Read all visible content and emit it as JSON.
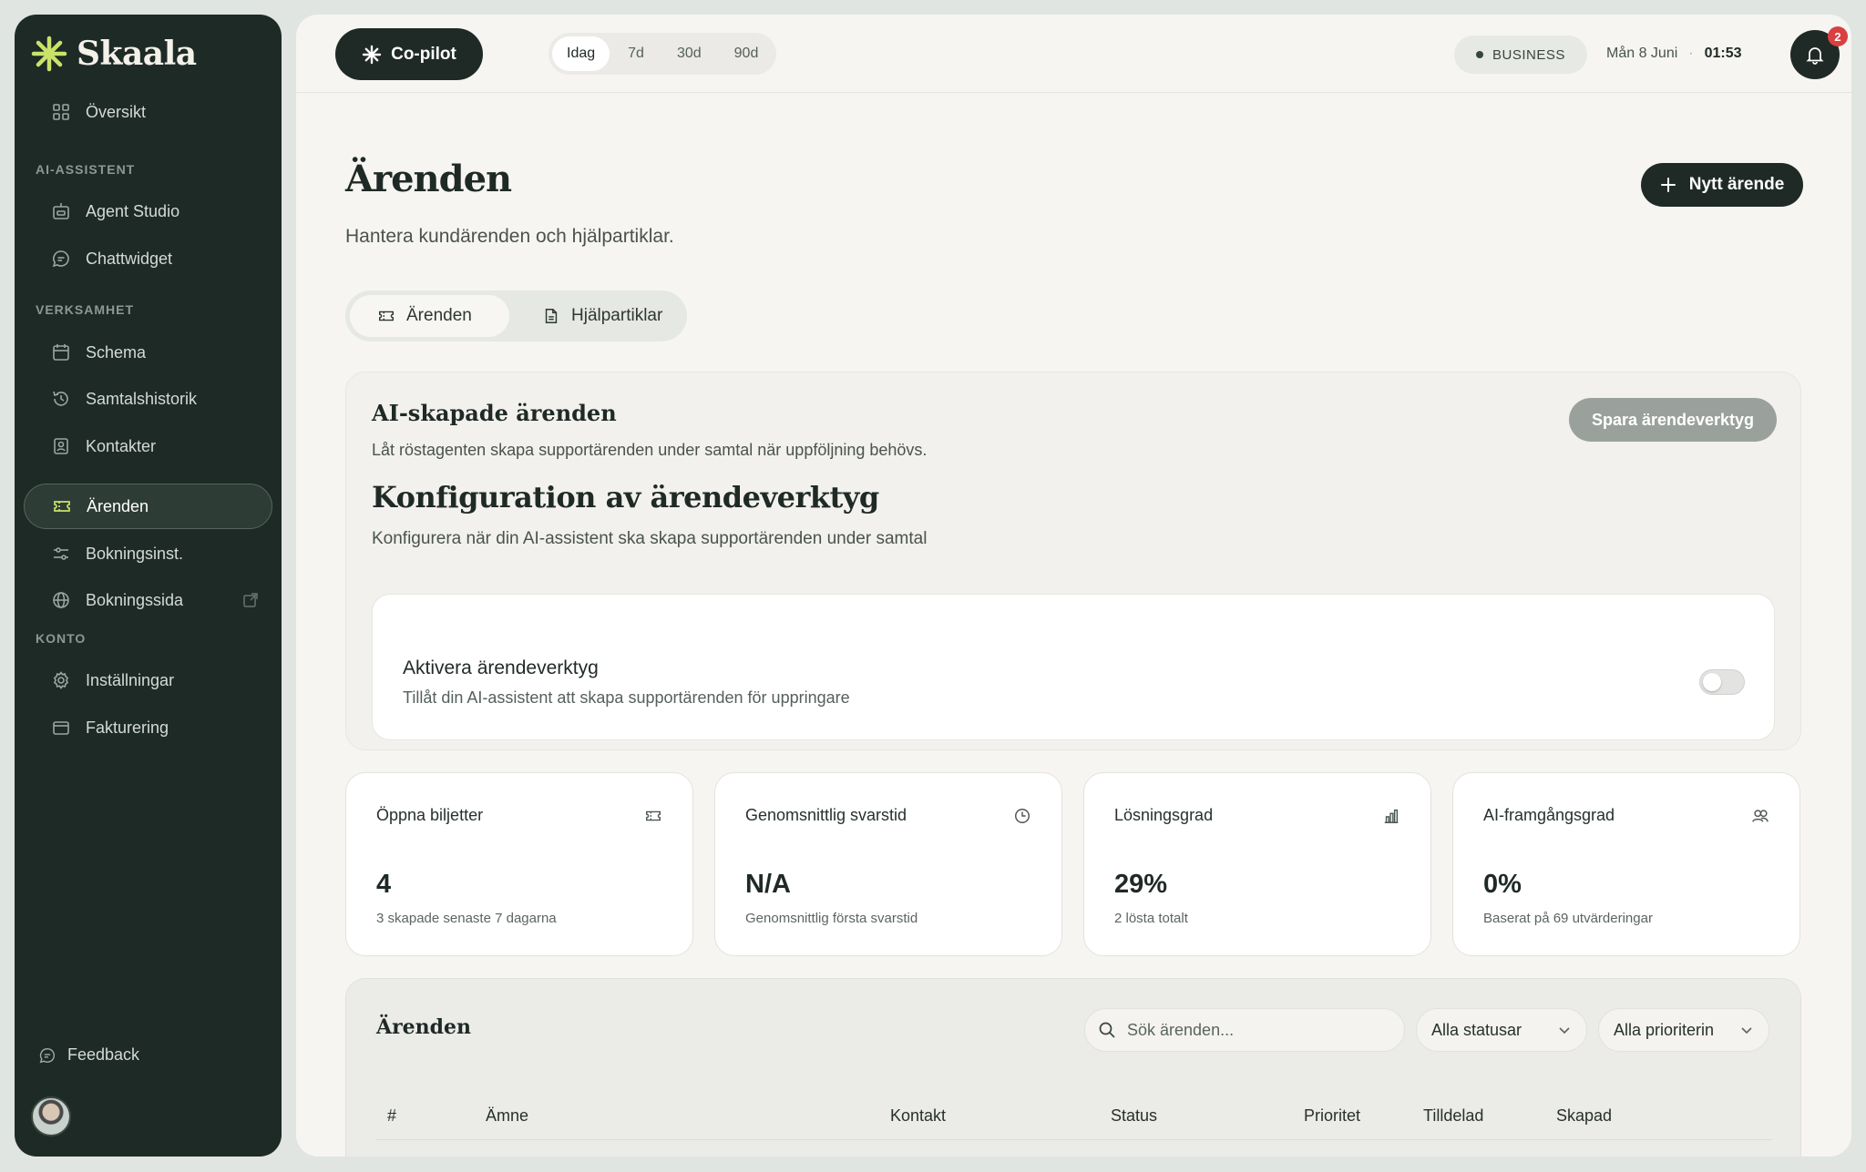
{
  "brand": {
    "name": "Skaala"
  },
  "sidebar": {
    "overview": "Översikt",
    "sections": {
      "ai": "AI-ASSISTENT",
      "business": "VERKSAMHET",
      "account": "KONTO"
    },
    "items": {
      "agent_studio": "Agent Studio",
      "chat_widget": "Chattwidget",
      "schedule": "Schema",
      "call_history": "Samtalshistorik",
      "contacts": "Kontakter",
      "tickets": "Ärenden",
      "booking_settings": "Bokningsinst.",
      "booking_page": "Bokningssida",
      "settings": "Inställningar",
      "billing": "Fakturering"
    },
    "feedback": "Feedback"
  },
  "topbar": {
    "copilot": "Co-pilot",
    "ranges": [
      "Idag",
      "7d",
      "30d",
      "90d"
    ],
    "active_range": "Idag",
    "plan": "BUSINESS",
    "date": "Mån 8 Juni",
    "separator": "·",
    "time": "01:53",
    "notifications": "2"
  },
  "page": {
    "title": "Ärenden",
    "subtitle": "Hantera kundärenden och hjälpartiklar.",
    "new_button": "Nytt ärende",
    "tabs": [
      "Ärenden",
      "Hjälpartiklar"
    ]
  },
  "config": {
    "title": "AI-skapade ärenden",
    "subtitle": "Låt röstagenten skapa supportärenden under samtal när uppföljning behövs.",
    "save_button": "Spara ärendeverktyg",
    "heading": "Konfiguration av ärendeverktyg",
    "description": "Konfigurera när din AI-assistent ska skapa supportärenden under samtal",
    "toggle_title": "Aktivera ärendeverktyg",
    "toggle_sub": "Tillåt din AI-assistent att skapa supportärenden för uppringare",
    "toggle_on": false
  },
  "stats": [
    {
      "label": "Öppna biljetter",
      "value": "4",
      "note": "3 skapade senaste 7 dagarna",
      "icon": "ticket-icon"
    },
    {
      "label": "Genomsnittlig svarstid",
      "value": "N/A",
      "note": "Genomsnittlig första svarstid",
      "icon": "clock-icon"
    },
    {
      "label": "Lösningsgrad",
      "value": "29%",
      "note": "2 lösta totalt",
      "icon": "bar-chart-icon"
    },
    {
      "label": "AI-framgångsgrad",
      "value": "0%",
      "note": "Baserat på 69 utvärderingar",
      "icon": "users-icon"
    }
  ],
  "table": {
    "title": "Ärenden",
    "search_placeholder": "Sök ärenden...",
    "status_filter": "Alla statusar",
    "priority_filter": "Alla prioriterin",
    "columns": [
      "#",
      "Ämne",
      "Kontakt",
      "Status",
      "Prioritet",
      "Tilldelad",
      "Skapad"
    ]
  },
  "colors": {
    "sidebar_bg": "#1e2a26",
    "accent_green": "#c9e26a",
    "badge_red": "#d94040"
  }
}
